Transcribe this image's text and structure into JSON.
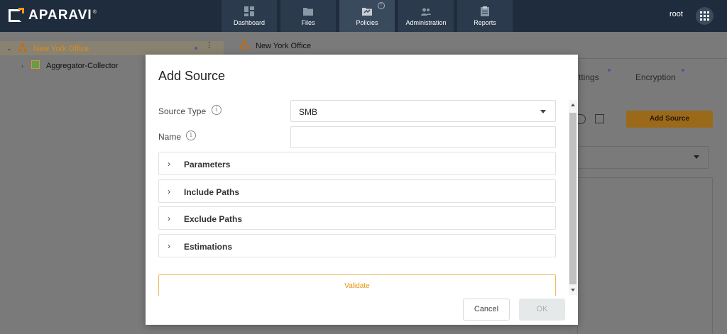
{
  "app": {
    "brand": "APARAVI",
    "brand_mark": "®",
    "accent": "#f39c12"
  },
  "nav": {
    "items": [
      {
        "label": "Dashboard",
        "icon": "dashboard-icon"
      },
      {
        "label": "Files",
        "icon": "folder-icon"
      },
      {
        "label": "Policies",
        "icon": "policies-icon",
        "badge": "!"
      },
      {
        "label": "Administration",
        "icon": "administration-icon"
      },
      {
        "label": "Reports",
        "icon": "reports-icon"
      }
    ],
    "active": "Policies"
  },
  "user": {
    "name": "root"
  },
  "tree": {
    "items": [
      {
        "label": "New York Office",
        "selected": true,
        "expanded": true
      },
      {
        "label": "Aggregator-Collector",
        "selected": false,
        "expanded": false
      }
    ]
  },
  "content": {
    "breadcrumb": "New York Office",
    "tabs": {
      "partial": "ttings",
      "encryption": "Encryption"
    },
    "add_source_label": "Add Source"
  },
  "modal": {
    "title": "Add Source",
    "source_type_label": "Source Type",
    "source_type_value": "SMB",
    "name_label": "Name",
    "name_value": "",
    "info_glyph": "i",
    "sections": [
      "Parameters",
      "Include Paths",
      "Exclude Paths",
      "Estimations"
    ],
    "validate_label": "Validate",
    "cancel_label": "Cancel",
    "ok_label": "OK"
  }
}
